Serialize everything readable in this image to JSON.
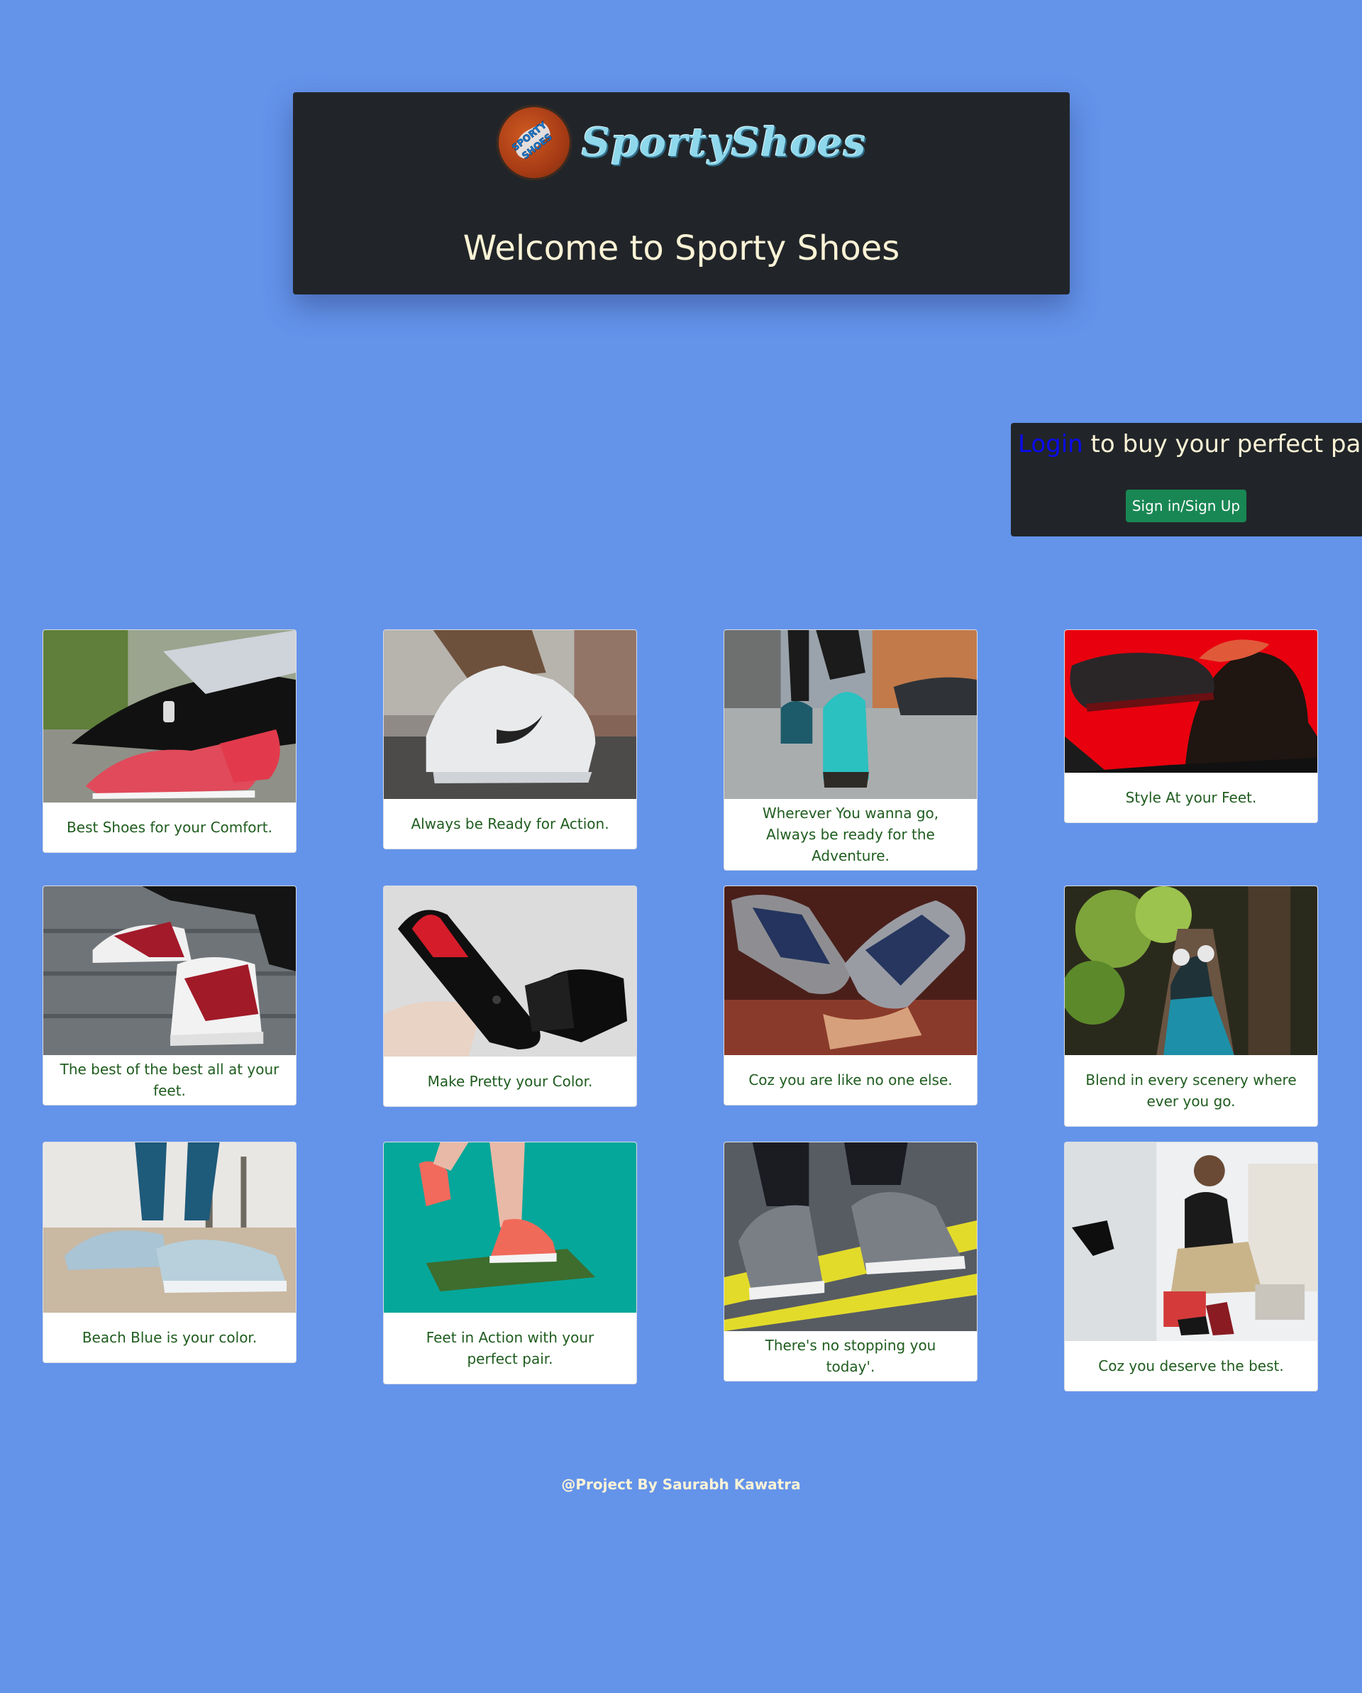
{
  "header": {
    "logo_badge_text": "SPORTY SHOES",
    "logo_wordmark": "SportyShoes",
    "welcome_title": "Welcome to Sporty Shoes"
  },
  "login": {
    "link_text": "Login",
    "rest_text": " to buy your perfect pair",
    "signin_button": "Sign in/Sign Up"
  },
  "cards": [
    {
      "caption": "Best Shoes for your Comfort.",
      "image": "woman-tying-red-sneaker-photo"
    },
    {
      "caption": "Always be Ready for Action.",
      "image": "white-sneaker-on-road-photo"
    },
    {
      "caption": "Wherever You wanna go, Always be ready for the Adventure.",
      "image": "walking-teal-sneakers-city-photo"
    },
    {
      "caption": "Style At your Feet.",
      "image": "man-holding-black-sneaker-red-background-photo"
    },
    {
      "caption": "The best of the best all at your feet.",
      "image": "red-white-high-tops-stairs-photo"
    },
    {
      "caption": "Make Pretty your Color.",
      "image": "black-patent-loafers-photo"
    },
    {
      "caption": "Coz you are like no one else.",
      "image": "bowling-style-shoes-photo"
    },
    {
      "caption": "Blend in every scenery where ever you go.",
      "image": "forest-log-sneakers-photo"
    },
    {
      "caption": "Beach Blue is your color.",
      "image": "light-blue-running-shoes-beach-photo"
    },
    {
      "caption": "Feet in Action with your perfect pair.",
      "image": "orange-sneakers-turf-teal-photo"
    },
    {
      "caption": "There's no stopping you today'.",
      "image": "grey-knit-sneakers-yellow-line-photo"
    },
    {
      "caption": "Coz you deserve the best.",
      "image": "woman-trying-heels-shop-photo"
    }
  ],
  "footer": {
    "credit": "@Project By Saurabh Kawatra"
  },
  "colors": {
    "page_background": "#6493ea",
    "panel": "#212529",
    "caption_text": "#1f5c1f",
    "button_green": "#198754",
    "login_link": "#0a0af0"
  }
}
